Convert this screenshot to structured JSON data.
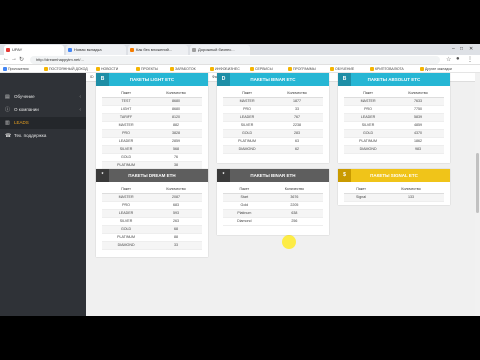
{
  "browser": {
    "tabs": [
      {
        "label": "UPAY",
        "color": "#e53935"
      },
      {
        "label": "Новая вкладка",
        "color": "#4285f4"
      },
      {
        "label": "Как без вложений...",
        "color": "#f57c00"
      },
      {
        "label": "Дорожный бизнес...",
        "color": "#9e9e9e"
      }
    ],
    "url": "http://dreamhappytm.net/..."
  },
  "bookmarks": [
    {
      "label": "Приложения",
      "color": "#4285f4"
    },
    {
      "label": "ПОСТОЯННЫЙ ДОХОД",
      "color": "#f4b400"
    },
    {
      "label": "НОВОСТИ",
      "color": "#f4b400"
    },
    {
      "label": "ПРОЕКТЫ",
      "color": "#f4b400"
    },
    {
      "label": "ЗАРАБОТОК",
      "color": "#f4b400"
    },
    {
      "label": "ИНФОБИЗНЕС",
      "color": "#f4b400"
    },
    {
      "label": "СЕРВИСЫ",
      "color": "#f4b400"
    },
    {
      "label": "ПРОГРАММЫ",
      "color": "#f4b400"
    },
    {
      "label": "ОБУЧЕНИЕ",
      "color": "#f4b400"
    },
    {
      "label": "КРИПТОВАЛЮТА",
      "color": "#f4b400"
    },
    {
      "label": "Другие закладки",
      "color": "#f4b400"
    }
  ],
  "sidebar": {
    "items": [
      {
        "label": "Обучение",
        "icon": "book-icon"
      },
      {
        "label": "О компании",
        "icon": "info-icon"
      },
      {
        "label": "LEADS",
        "icon": "chart-icon"
      },
      {
        "label": "Тех. поддержка",
        "icon": "support-icon"
      }
    ]
  },
  "filters": [
    "ID",
    "Email",
    "LIMIT",
    "Фамилия Сокращенная",
    "CLOSE",
    "Номер Счёт (лицевой)"
  ],
  "colors": {
    "cyan": "#26b6d4",
    "gray": "#5e5e5e",
    "gold": "#f0c419",
    "tag_cyan": "#1e8ea6",
    "tag_gray": "#3a3a3a",
    "tag_gold": "#c99a00"
  },
  "panels": [
    {
      "tag": "B",
      "title": "ПАКЕТЫ LIGHT ETC",
      "theme": "cyan",
      "columns": [
        "Пакет",
        "Количество"
      ],
      "rows": [
        [
          "TEST",
          "8680"
        ],
        [
          "LIGHT",
          "8680"
        ],
        [
          "TARIFF",
          "8120"
        ],
        [
          "MASTER",
          "882"
        ],
        [
          "PRO",
          "3828"
        ],
        [
          "LEADER",
          "2859"
        ],
        [
          "SILVER",
          "568"
        ],
        [
          "GOLD",
          "76"
        ],
        [
          "PLATINUM",
          "38"
        ],
        [
          "DIAMOND",
          "17"
        ]
      ]
    },
    {
      "tag": "D",
      "title": "ПАКЕТЫ BINAR ETC",
      "theme": "cyan",
      "columns": [
        "Пакет",
        "Количество"
      ],
      "rows": [
        [
          "MASTER",
          "1877"
        ],
        [
          "PRO",
          "33"
        ],
        [
          "LEADER",
          "767"
        ],
        [
          "SILVER",
          "2238"
        ],
        [
          "GOLD",
          "283"
        ],
        [
          "PLATINUM",
          "63"
        ],
        [
          "DIAMOND",
          "62"
        ]
      ]
    },
    {
      "tag": "B",
      "title": "ПАКЕТЫ ABSOLUT ETC",
      "theme": "cyan",
      "columns": [
        "Пакет",
        "Количество"
      ],
      "rows": [
        [
          "MASTER",
          "7633"
        ],
        [
          "PRO",
          "7750"
        ],
        [
          "LEADER",
          "5839"
        ],
        [
          "SILVER",
          "4859"
        ],
        [
          "GOLD",
          "4370"
        ],
        [
          "PLATINUM",
          "1862"
        ],
        [
          "DIAMOND",
          "983"
        ]
      ]
    },
    {
      "tag": "*",
      "title": "ПАКЕТЫ DREAM ETH",
      "theme": "gray",
      "columns": [
        "Пакет",
        "Количество"
      ],
      "rows": [
        [
          "MASTER",
          "2087"
        ],
        [
          "PRO",
          "683"
        ],
        [
          "LEADER",
          "593"
        ],
        [
          "SILVER",
          "263"
        ],
        [
          "GOLD",
          "68"
        ],
        [
          "PLATINUM",
          "88"
        ],
        [
          "DIAMOND",
          "33"
        ]
      ]
    },
    {
      "tag": "*",
      "title": "ПАКЕТЫ BINAR ETH",
      "theme": "gray",
      "columns": [
        "Пакет",
        "Количество"
      ],
      "rows": [
        [
          "Start",
          "3676"
        ],
        [
          "Gold",
          "2205"
        ],
        [
          "Platinum",
          "638"
        ],
        [
          "Diamond",
          "256"
        ]
      ]
    },
    {
      "tag": "$",
      "title": "ПАКЕТЫ SIGNAL ETC",
      "theme": "gold",
      "columns": [
        "Пакет",
        "Количество"
      ],
      "rows": [
        [
          "Signal",
          "133"
        ]
      ]
    }
  ]
}
